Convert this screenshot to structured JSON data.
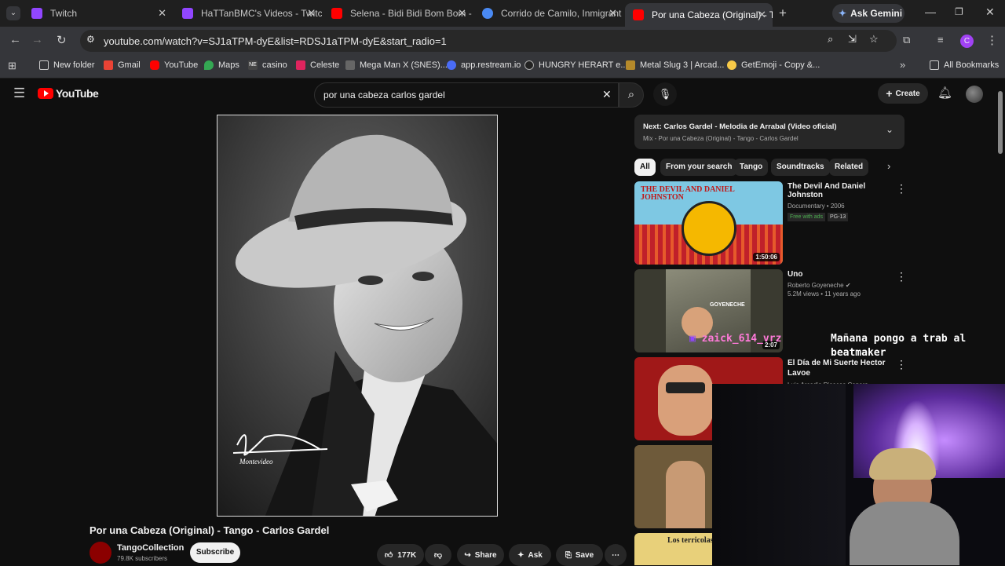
{
  "tabs": [
    {
      "label": "Twitch",
      "color": "#9146ff"
    },
    {
      "label": "HaTTanBMC's Videos - Twitch",
      "color": "#9146ff"
    },
    {
      "label": "Selena - Bidi Bidi Bom Bom -",
      "color": "#ff0000"
    },
    {
      "label": "Corrido de Camilo, Inmigrant",
      "color": "#4a8af4"
    },
    {
      "label": "Por una Cabeza (Original) - Ta",
      "color": "#ff0000"
    }
  ],
  "gemini_label": "Ask Gemini",
  "url": "youtube.com/watch?v=SJ1aTPM-dyE&list=RDSJ1aTPM-dyE&start_radio=1",
  "bookmarks": [
    "New folder",
    "Gmail",
    "YouTube",
    "Maps",
    "casino",
    "Celeste",
    "Mega Man X (SNES)...",
    "app.restream.io",
    "HUNGRY HERART e...",
    "Metal Slug 3 | Arcad...",
    "GetEmoji - Copy &..."
  ],
  "all_bookmarks": "All Bookmarks",
  "yt": {
    "logo": "YouTube",
    "search_value": "por una cabeza carlos gardel",
    "create": "Create",
    "avatar": "C"
  },
  "signature": "Montevideo",
  "video": {
    "title": "Por una Cabeza (Original) - Tango - Carlos Gardel",
    "channel": "TangoCollection",
    "subscribers": "79.8K subscribers",
    "subscribe": "Subscribe",
    "likes": "177K",
    "share": "Share",
    "ask": "Ask",
    "save": "Save"
  },
  "next": {
    "title": "Next: Carlos Gardel - Melodia de Arrabal (Video oficial)",
    "sub": "Mix - Por una Cabeza (Original) - Tango - Carlos Gardel"
  },
  "chips": [
    "All",
    "From your search",
    "Tango",
    "Soundtracks",
    "Related"
  ],
  "recs": [
    {
      "title": "The Devil And Daniel Johnston",
      "line1": "Documentary • 2006",
      "badge1": "Free with ads",
      "badge2": "PG-13",
      "duration": "1:50:06",
      "thumb_text": "THE DEVIL AND DANIEL JOHNSTON"
    },
    {
      "title": "Uno",
      "line1": "Roberto Goyeneche",
      "line2": "5.2M views • 11 years ago",
      "duration": "2:07",
      "thumb_text": "GOYENECHE"
    },
    {
      "title": "El Día de Mi Suerte   Hector Lavoe",
      "line1": "Luis Arcadio Risecos Capera"
    },
    {
      "thumb_text": "Los terricolas"
    }
  ],
  "chat": {
    "user": "zaick_614_vrz",
    "message": "Mañana pongo a trab al beatmaker"
  }
}
